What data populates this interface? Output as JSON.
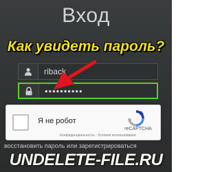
{
  "header": {
    "title": "Вход"
  },
  "headline": {
    "text": "Как увидеть пароль?"
  },
  "form": {
    "username_value": "riback",
    "password_value": "••••••••••",
    "username_icon": "user-icon",
    "password_icon": "lock-icon"
  },
  "captcha": {
    "label": "Я не робот",
    "brand": "reCAPTCHA",
    "privacy": "Конфиденциальность - Условия использования"
  },
  "footer": {
    "links_text": "восстановить пароль или зарегистрироваться"
  },
  "banner": {
    "text": "UNDELETE-FILE.RU"
  },
  "colors": {
    "background": "#2b2d2e",
    "headline": "#f3e21a",
    "focus_border": "#5bd01e",
    "arrow": "#e3141b",
    "captcha_bg": "#f9f9f9"
  }
}
